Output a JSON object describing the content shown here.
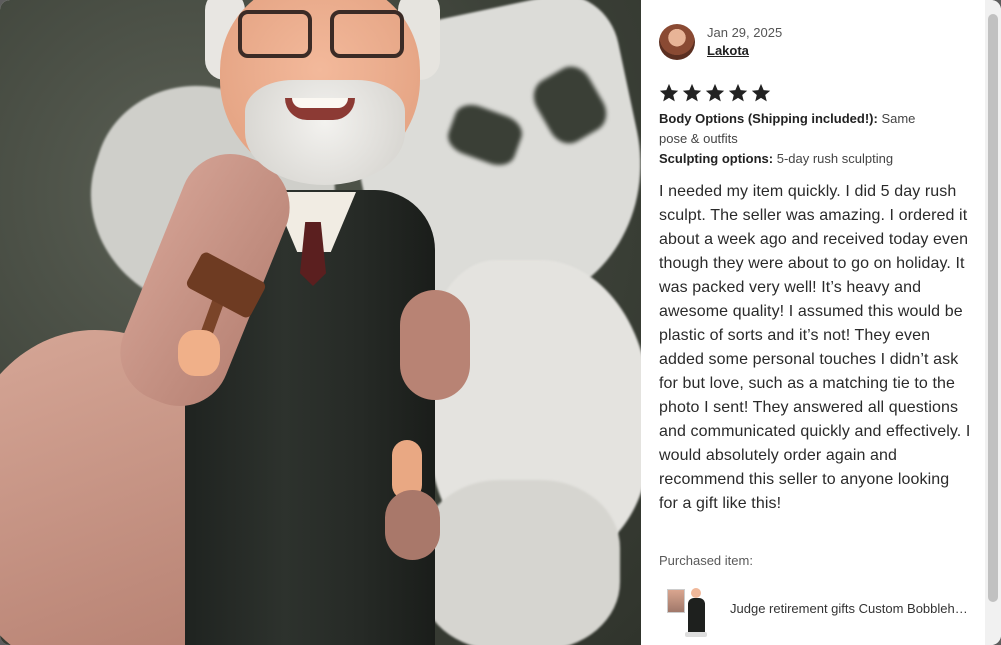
{
  "review": {
    "date": "Jan 29, 2025",
    "reviewer_name": "Lakota",
    "rating": 5,
    "options": [
      {
        "label": "Body Options (Shipping included!):",
        "value": "Same pose & outfits"
      },
      {
        "label": "Sculpting options:",
        "value": "5-day rush sculpting"
      }
    ],
    "text": "I needed my item quickly. I did 5 day rush sculpt. The seller was amazing. I ordered it about a week ago and received today even though they were about to go on holiday. It was packed very well! It’s heavy and awesome quality! I assumed this would be plastic of sorts and it’s not! They even added some personal touches I didn’t ask for but love, such as a matching tie to the photo I sent! They answered all questions and communicated quickly and effectively. I would absolutely order again and recommend this seller to anyone looking for a gift like this!",
    "purchased_label": "Purchased item:",
    "item_title": "Judge retirement gifts Custom Bobblehead"
  },
  "icons": {
    "star": "star-icon",
    "avatar": "reviewer-avatar"
  },
  "colors": {
    "star": "#222222",
    "text": "#2a2a2a",
    "muted": "#595959"
  }
}
